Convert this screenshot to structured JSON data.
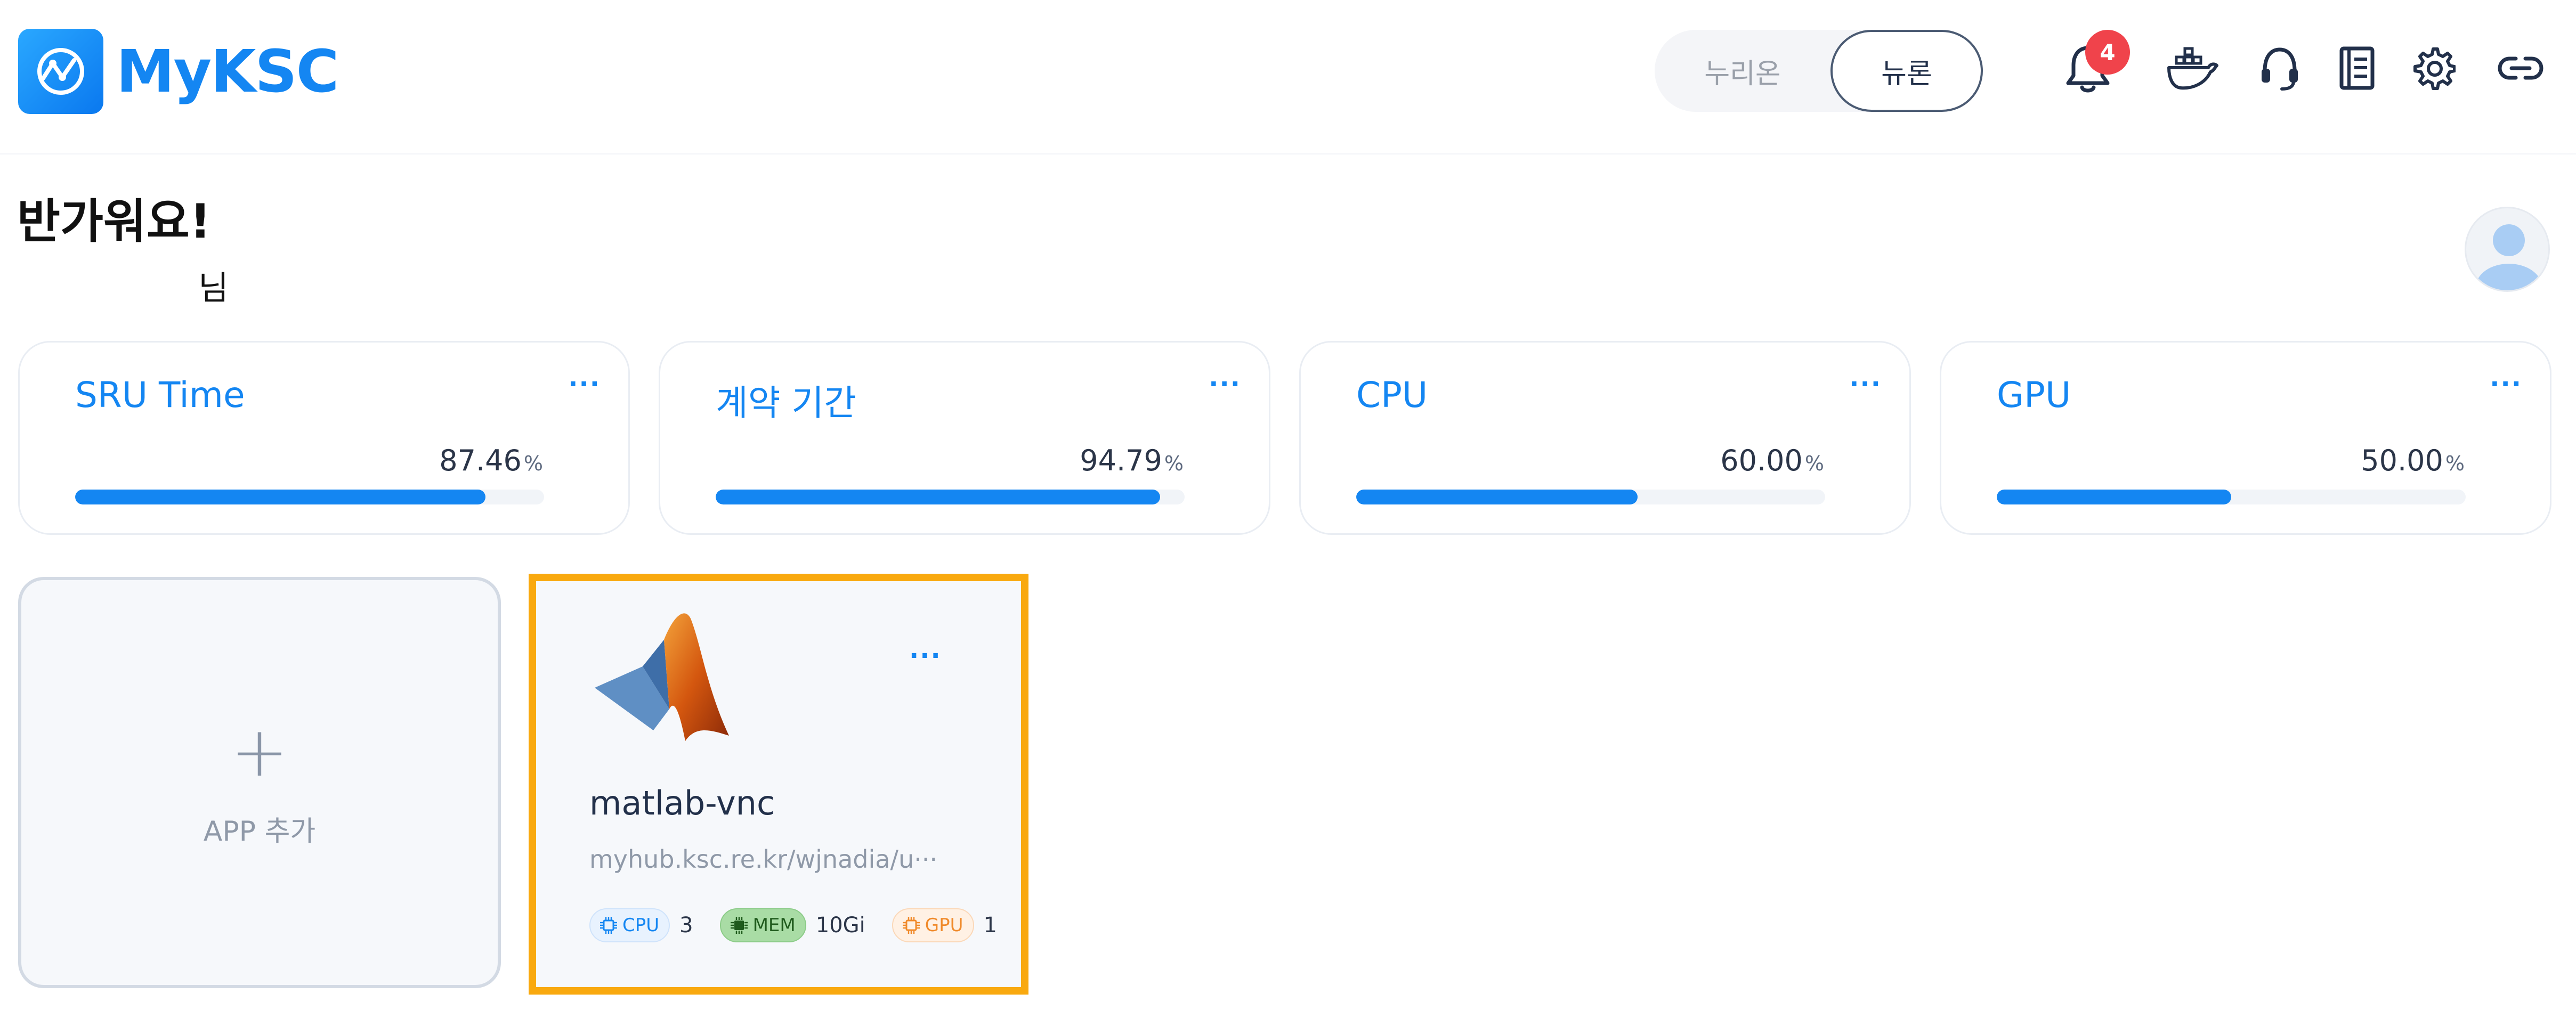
{
  "header": {
    "logo_text": "MyKSC",
    "toggle": {
      "options": [
        "누리온",
        "뉴론"
      ],
      "selected": "뉴론"
    },
    "notification_count": "4",
    "icons": [
      "bell-icon",
      "docker-icon",
      "headset-icon",
      "notebook-icon",
      "gear-icon",
      "link-icon"
    ]
  },
  "greeting": {
    "title": "반가워요!",
    "name_suffix": "님"
  },
  "stats": [
    {
      "title": "SRU Time",
      "value": "87.46",
      "unit": "%",
      "fraction": 0.8746
    },
    {
      "title": "계약 기간",
      "value": "94.79",
      "unit": "%",
      "fraction": 0.9479
    },
    {
      "title": "CPU",
      "value": "60.00",
      "unit": "%",
      "fraction": 0.6
    },
    {
      "title": "GPU",
      "value": "50.00",
      "unit": "%",
      "fraction": 0.5
    }
  ],
  "more_label": "···",
  "add_app": {
    "plus": "+",
    "label": "APP 추가"
  },
  "app": {
    "name": "matlab-vnc",
    "url": "myhub.ksc.re.kr/wjnadia/u···",
    "resources": [
      {
        "label": "CPU",
        "value": "3"
      },
      {
        "label": "MEM",
        "value": "10Gi"
      },
      {
        "label": "GPU",
        "value": "1"
      }
    ]
  },
  "colors": {
    "accent": "#1486f2",
    "badge": "#f0434b",
    "highlight": "#f9a90f"
  }
}
